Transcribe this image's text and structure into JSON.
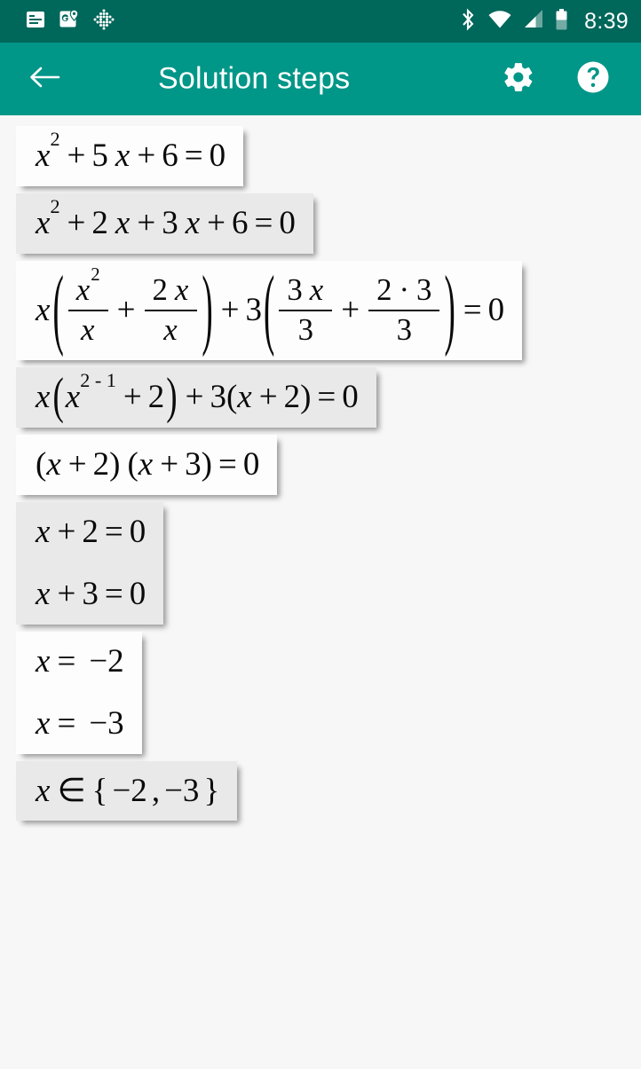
{
  "status_bar": {
    "icons_left": [
      "article-icon",
      "google-maps-icon",
      "dots-diamond-icon"
    ],
    "icons_right": [
      "bluetooth-icon",
      "wifi-icon",
      "cell-signal-icon",
      "battery-icon"
    ],
    "time": "8:39",
    "background_color": "#00675b"
  },
  "app_bar": {
    "back_label": "back-arrow",
    "title": "Solution steps",
    "settings_label": "settings-gear",
    "help_label": "help-question",
    "background_color": "#009688",
    "text_color": "#ffffff"
  },
  "steps": [
    {
      "index": 1,
      "shade": "light",
      "expression": "x^2 + 5 x + 6 = 0",
      "lines": [
        [
          {
            "t": "var",
            "v": "x",
            "sup": "2"
          },
          {
            "t": "op",
            "v": "+"
          },
          {
            "t": "num",
            "v": "5"
          },
          {
            "t": "sp"
          },
          {
            "t": "var",
            "v": "x"
          },
          {
            "t": "op",
            "v": "+"
          },
          {
            "t": "num",
            "v": "6"
          },
          {
            "t": "op",
            "v": "="
          },
          {
            "t": "num",
            "v": "0"
          }
        ]
      ]
    },
    {
      "index": 2,
      "shade": "gray",
      "expression": "x^2 + 2 x + 3 x + 6 = 0",
      "lines": [
        [
          {
            "t": "var",
            "v": "x",
            "sup": "2"
          },
          {
            "t": "op",
            "v": "+"
          },
          {
            "t": "num",
            "v": "2"
          },
          {
            "t": "sp"
          },
          {
            "t": "var",
            "v": "x"
          },
          {
            "t": "op",
            "v": "+"
          },
          {
            "t": "num",
            "v": "3"
          },
          {
            "t": "sp"
          },
          {
            "t": "var",
            "v": "x"
          },
          {
            "t": "op",
            "v": "+"
          },
          {
            "t": "num",
            "v": "6"
          },
          {
            "t": "op",
            "v": "="
          },
          {
            "t": "num",
            "v": "0"
          }
        ]
      ]
    },
    {
      "index": 3,
      "shade": "light",
      "expression": "x ( x^2/x + 2 x/x ) + 3 ( 3 x/3 + 2 · 3/3 ) = 0",
      "lines": [
        [
          {
            "t": "var",
            "v": "x"
          },
          {
            "t": "bigparen",
            "v": "("
          },
          {
            "t": "frac",
            "num": "x^2",
            "den": "x"
          },
          {
            "t": "op",
            "v": "+"
          },
          {
            "t": "frac",
            "num": "2 x",
            "den": "x"
          },
          {
            "t": "bigparen",
            "v": ")"
          },
          {
            "t": "op",
            "v": "+"
          },
          {
            "t": "num",
            "v": "3"
          },
          {
            "t": "bigparen",
            "v": "("
          },
          {
            "t": "frac",
            "num": "3 x",
            "den": "3"
          },
          {
            "t": "op",
            "v": "+"
          },
          {
            "t": "frac",
            "num": "2 · 3",
            "den": "3"
          },
          {
            "t": "bigparen",
            "v": ")"
          },
          {
            "t": "op",
            "v": "="
          },
          {
            "t": "num",
            "v": "0"
          }
        ]
      ]
    },
    {
      "index": 4,
      "shade": "gray",
      "expression": "x ( x^(2 - 1) + 2 ) + 3 ( x + 2 ) = 0",
      "lines": [
        [
          {
            "t": "var",
            "v": "x"
          },
          {
            "t": "medparen",
            "v": "("
          },
          {
            "t": "var",
            "v": "x",
            "sup": "2 - 1"
          },
          {
            "t": "op",
            "v": "+"
          },
          {
            "t": "num",
            "v": "2"
          },
          {
            "t": "medparen",
            "v": ")"
          },
          {
            "t": "op",
            "v": "+"
          },
          {
            "t": "num",
            "v": "3"
          },
          {
            "t": "paren",
            "v": "("
          },
          {
            "t": "var",
            "v": "x"
          },
          {
            "t": "op",
            "v": "+"
          },
          {
            "t": "num",
            "v": "2"
          },
          {
            "t": "paren",
            "v": ")"
          },
          {
            "t": "op",
            "v": "="
          },
          {
            "t": "num",
            "v": "0"
          }
        ]
      ]
    },
    {
      "index": 5,
      "shade": "light",
      "expression": "( x + 2 ) ( x + 3 ) = 0",
      "lines": [
        [
          {
            "t": "paren",
            "v": "("
          },
          {
            "t": "var",
            "v": "x"
          },
          {
            "t": "op",
            "v": "+"
          },
          {
            "t": "num",
            "v": "2"
          },
          {
            "t": "paren",
            "v": ")"
          },
          {
            "t": "sp"
          },
          {
            "t": "paren",
            "v": "("
          },
          {
            "t": "var",
            "v": "x"
          },
          {
            "t": "op",
            "v": "+"
          },
          {
            "t": "num",
            "v": "3"
          },
          {
            "t": "paren",
            "v": ")"
          },
          {
            "t": "op",
            "v": "="
          },
          {
            "t": "num",
            "v": "0"
          }
        ]
      ]
    },
    {
      "index": 6,
      "shade": "gray",
      "expression": "x + 2 = 0 ; x + 3 = 0",
      "lines": [
        [
          {
            "t": "var",
            "v": "x"
          },
          {
            "t": "op",
            "v": "+"
          },
          {
            "t": "num",
            "v": "2"
          },
          {
            "t": "op",
            "v": "="
          },
          {
            "t": "num",
            "v": "0"
          }
        ],
        [
          {
            "t": "var",
            "v": "x"
          },
          {
            "t": "op",
            "v": "+"
          },
          {
            "t": "num",
            "v": "3"
          },
          {
            "t": "op",
            "v": "="
          },
          {
            "t": "num",
            "v": "0"
          }
        ]
      ]
    },
    {
      "index": 7,
      "shade": "light",
      "expression": "x = -2 ; x = -3",
      "lines": [
        [
          {
            "t": "var",
            "v": "x"
          },
          {
            "t": "op",
            "v": "="
          },
          {
            "t": "sp"
          },
          {
            "t": "num",
            "v": "−2"
          }
        ],
        [
          {
            "t": "var",
            "v": "x"
          },
          {
            "t": "op",
            "v": "="
          },
          {
            "t": "sp"
          },
          {
            "t": "num",
            "v": "−3"
          }
        ]
      ]
    },
    {
      "index": 8,
      "shade": "gray",
      "expression": "x ∈ { −2 , −3 }",
      "lines": [
        [
          {
            "t": "var",
            "v": "x"
          },
          {
            "t": "op",
            "v": "∈"
          },
          {
            "t": "num",
            "v": "{"
          },
          {
            "t": "opt",
            "v": "−2"
          },
          {
            "t": "num",
            "v": ","
          },
          {
            "t": "opt",
            "v": "−3"
          },
          {
            "t": "num",
            "v": "}"
          }
        ]
      ]
    }
  ]
}
